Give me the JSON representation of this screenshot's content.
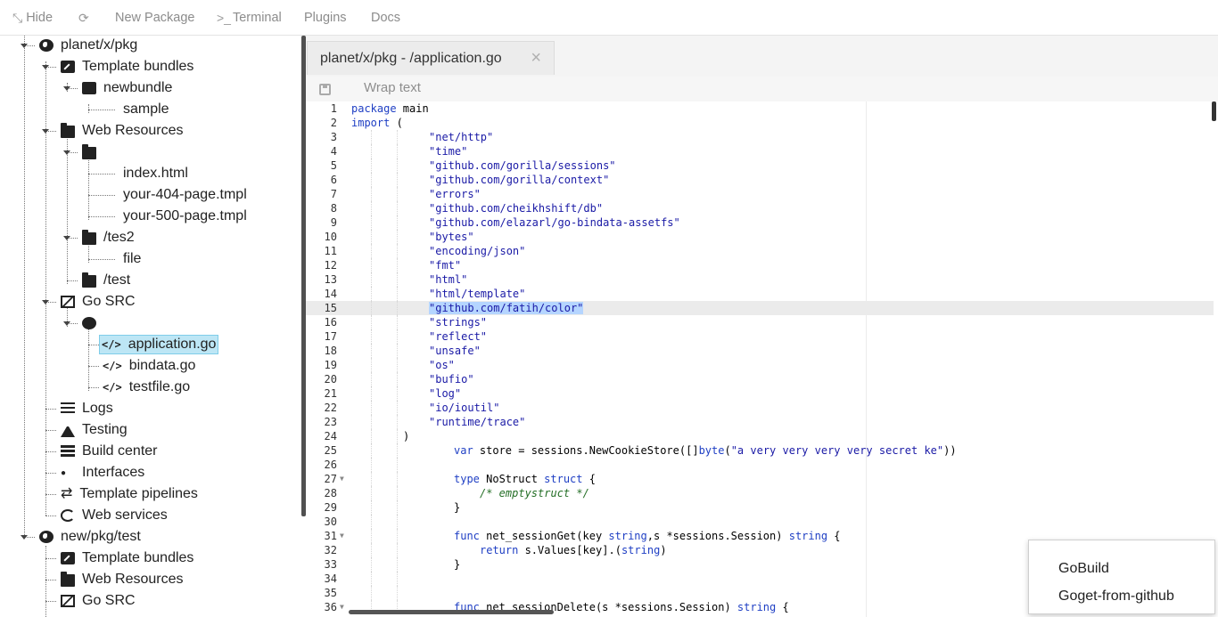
{
  "toolbar": {
    "hide": "Hide",
    "new_package": "New Package",
    "terminal": "Terminal",
    "terminal_prefix": ">_",
    "plugins": "Plugins",
    "docs": "Docs"
  },
  "tree": [
    {
      "label": "planet/x/pkg",
      "icon": "globe-icon"
    },
    {
      "label": "Template bundles",
      "icon": "edit-icon"
    },
    {
      "label": "newbundle",
      "icon": "square-icon"
    },
    {
      "label": "sample",
      "icon": ""
    },
    {
      "label": "Web Resources",
      "icon": "folder-icon"
    },
    {
      "label": "",
      "icon": "folder-icon"
    },
    {
      "label": "index.html",
      "icon": ""
    },
    {
      "label": "your-404-page.tmpl",
      "icon": ""
    },
    {
      "label": "your-500-page.tmpl",
      "icon": ""
    },
    {
      "label": "/tes2",
      "icon": "folder-icon"
    },
    {
      "label": "file",
      "icon": ""
    },
    {
      "label": "/test",
      "icon": "folder-icon"
    },
    {
      "label": "Go SRC",
      "icon": "cube-icon"
    },
    {
      "label": "",
      "icon": "circle-icon"
    },
    {
      "label": "application.go",
      "icon": "code-icon"
    },
    {
      "label": "bindata.go",
      "icon": "code-icon"
    },
    {
      "label": "testfile.go",
      "icon": "code-icon"
    },
    {
      "label": "Logs",
      "icon": "list-icon"
    },
    {
      "label": "Testing",
      "icon": "flask-icon"
    },
    {
      "label": "Build center",
      "icon": "server-icon"
    },
    {
      "label": "Interfaces",
      "icon": "share-icon"
    },
    {
      "label": "Template pipelines",
      "icon": "exchange-icon"
    },
    {
      "label": "Web services",
      "icon": "ring-icon"
    },
    {
      "label": "new/pkg/test",
      "icon": "globe-icon"
    },
    {
      "label": "Template bundles",
      "icon": "edit-icon"
    },
    {
      "label": "Web Resources",
      "icon": "folder-icon"
    },
    {
      "label": "Go SRC",
      "icon": "cube-icon"
    }
  ],
  "editor": {
    "tab_title": "planet/x/pkg - /application.go",
    "tab_close": "×",
    "wrap_text": "Wrap text",
    "active_line": 15,
    "lines": [
      {
        "n": "1",
        "text": "package main"
      },
      {
        "n": "2",
        "text": "import ("
      },
      {
        "n": "3",
        "text": "\t\"net/http\""
      },
      {
        "n": "4",
        "text": "\t\"time\""
      },
      {
        "n": "5",
        "text": "\t\"github.com/gorilla/sessions\""
      },
      {
        "n": "6",
        "text": "\t\"github.com/gorilla/context\""
      },
      {
        "n": "7",
        "text": "\t\"errors\""
      },
      {
        "n": "8",
        "text": "\t\"github.com/cheikhshift/db\""
      },
      {
        "n": "9",
        "text": "\t\"github.com/elazarl/go-bindata-assetfs\""
      },
      {
        "n": "10",
        "text": "\t\"bytes\""
      },
      {
        "n": "11",
        "text": "\t\"encoding/json\""
      },
      {
        "n": "12",
        "text": "\t\"fmt\""
      },
      {
        "n": "13",
        "text": "\t\"html\""
      },
      {
        "n": "14",
        "text": "\t\"html/template\""
      },
      {
        "n": "15",
        "text": "\t\"github.com/fatih/color\""
      },
      {
        "n": "16",
        "text": "\t\"strings\""
      },
      {
        "n": "17",
        "text": "\t\"reflect\""
      },
      {
        "n": "18",
        "text": "\t\"unsafe\""
      },
      {
        "n": "19",
        "text": "\t\"os\""
      },
      {
        "n": "20",
        "text": "\t\"bufio\""
      },
      {
        "n": "21",
        "text": "\t\"log\""
      },
      {
        "n": "22",
        "text": "\t\"io/ioutil\""
      },
      {
        "n": "23",
        "text": "\t\"runtime/trace\""
      },
      {
        "n": "24",
        "text": ")"
      },
      {
        "n": "25",
        "text": "var store = sessions.NewCookieStore([]byte(\"a very very very very secret ke\"))"
      },
      {
        "n": "26",
        "text": ""
      },
      {
        "n": "27",
        "text": "type NoStruct struct {"
      },
      {
        "n": "28",
        "text": "/* emptystruct */"
      },
      {
        "n": "29",
        "text": "}"
      },
      {
        "n": "30",
        "text": ""
      },
      {
        "n": "31",
        "text": "func net_sessionGet(key string,s *sessions.Session) string {"
      },
      {
        "n": "32",
        "text": "return s.Values[key].(string)"
      },
      {
        "n": "33",
        "text": "}"
      },
      {
        "n": "34",
        "text": ""
      },
      {
        "n": "35",
        "text": ""
      },
      {
        "n": "36",
        "text": "func net_sessionDelete(s *sessions.Session) string {"
      }
    ]
  },
  "context_menu": {
    "items": [
      "GoBuild",
      "Goget-from-github"
    ]
  }
}
